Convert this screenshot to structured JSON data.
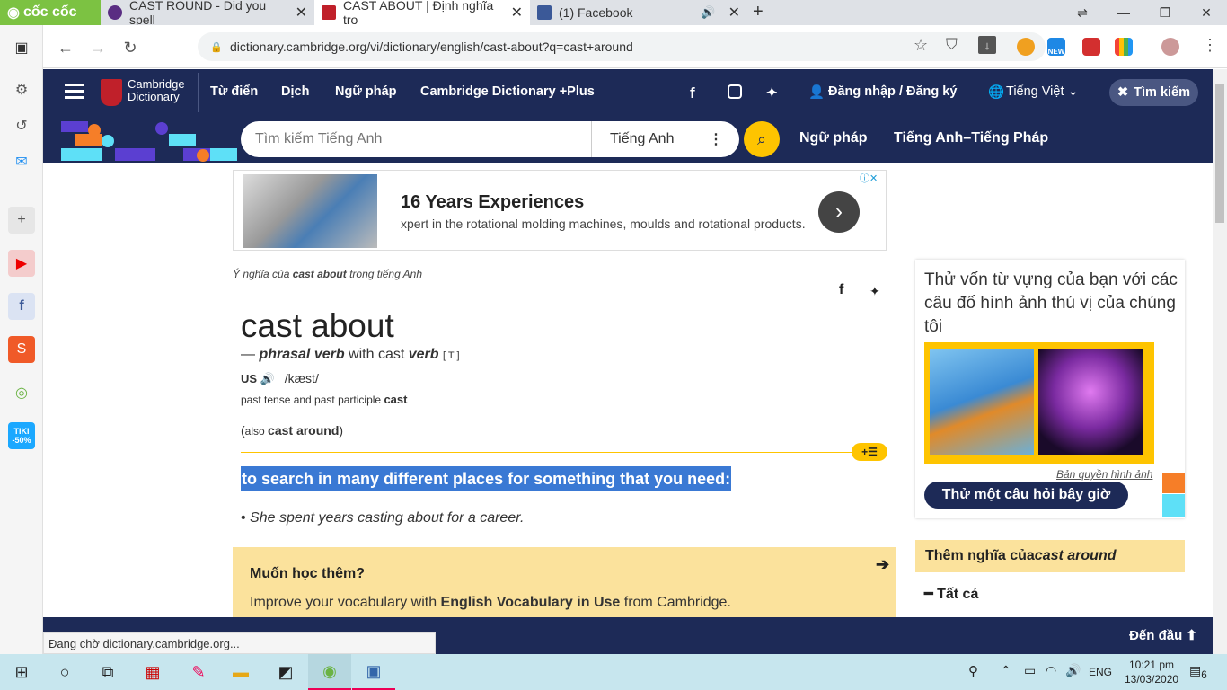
{
  "browser": {
    "logo": "cốc cốc",
    "tabs": [
      {
        "title": "CAST ROUND - Did you spell"
      },
      {
        "title": "CAST ABOUT | Định nghĩa tro"
      },
      {
        "title": "(1) Facebook"
      }
    ],
    "url": "dictionary.cambridge.org/vi/dictionary/english/cast-about?q=cast+around",
    "status": "Đang chờ dictionary.cambridge.org...",
    "ext_new": "NEW"
  },
  "header": {
    "logo_line1": "Cambridge",
    "logo_line2": "Dictionary",
    "nav": [
      "Từ điển",
      "Dịch",
      "Ngữ pháp",
      "Cambridge Dictionary +Plus"
    ],
    "login": "Đăng nhập / Đăng ký",
    "language": "Tiếng Việt",
    "search_toggle": "Tìm kiếm"
  },
  "search": {
    "placeholder": "Tìm kiếm Tiếng Anh",
    "lang": "Tiếng Anh",
    "links": [
      "Ngữ pháp",
      "Tiếng Anh–Tiếng Pháp"
    ]
  },
  "ad": {
    "title": "16 Years Experiences",
    "text": "xpert in the rotational molding machines, moulds and rotational products."
  },
  "entry": {
    "meaning_prefix": "Ý nghĩa của ",
    "meaning_word": "cast about",
    "meaning_suffix": " trong tiếng Anh",
    "headword": "cast about",
    "pos_dash": "— ",
    "pos": "phrasal verb",
    "pos_with": " with cast ",
    "pos_verb": "verb",
    "grammar": "[ T ]",
    "region": "US",
    "ipa": "/kæst/",
    "past_label": "past tense and past participle ",
    "past_word": "cast",
    "also_open": "(",
    "also_label": "also ",
    "also_word": "cast around",
    "also_close": ")",
    "definition": "to search in many different places for something that you need:",
    "example": "She spent years casting about for a career."
  },
  "learn": {
    "title": "Muốn học thêm?",
    "text_prefix": "Improve your vocabulary with ",
    "text_bold": "English Vocabulary in Use",
    "text_suffix": " from Cambridge."
  },
  "sidebar_card": {
    "text": "Thử vốn từ vựng của bạn với các câu đố hình ảnh thú vị của chúng tôi",
    "credit": "Bản quyền hình ảnh",
    "button": "Thử một câu hỏi bây giờ"
  },
  "more": {
    "prefix": "Thêm nghĩa của ",
    "word": "cast around",
    "item": "Tất cả"
  },
  "bottom": {
    "to_top": "Đến đầu"
  },
  "taskbar": {
    "lang": "ENG",
    "time": "10:21 pm",
    "date": "13/03/2020",
    "notif": "6"
  },
  "colors": {
    "navy": "#1d2a57",
    "yellow": "#fec400",
    "highlight": "#3a79d4",
    "pale": "#fbe29c"
  }
}
